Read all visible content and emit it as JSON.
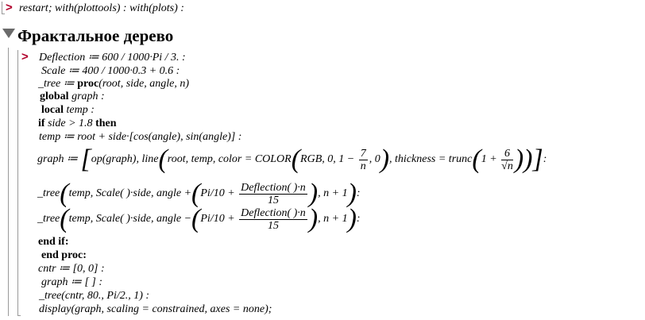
{
  "header_line": {
    "prompt": ">",
    "text": "restart; with(plottools) : with(plots) :"
  },
  "section": {
    "title": "Фрактальное дерево"
  },
  "code": {
    "prompt": ">",
    "l1": "Deflection ≔ 600 / 1000·Pi / 3. :",
    "l2": "Scale ≔ 400 / 1000·0.3 + 0.6 :",
    "l3_a": "_tree ≔ ",
    "l3_b": "proc",
    "l3_c": "(root, side, angle, n)",
    "l4_a": "global",
    "l4_b": " graph :",
    "l5_a": "local",
    "l5_b": " temp :",
    "l6_a": "if",
    "l6_b": " side > 1.8 ",
    "l6_c": "then",
    "l7": "temp ≔ root + side·[cos(angle), sin(angle)] :",
    "l8_a": "graph ≔ ",
    "l8_b": "op(graph), line",
    "l8_c": "root, temp, color = COLOR",
    "l8_d": "RGB, 0, 1 − ",
    "l8_num1": "7",
    "l8_den1": "n",
    "l8_e": ", 0",
    "l8_f": ", thickness = trunc",
    "l8_g": "1 + ",
    "l8_num2": "6",
    "l8_den2": "√n",
    "l8_end": ":",
    "l9_a": "_tree",
    "l9_b": "temp, Scale( )·side, angle +",
    "l9_c": "Pi/10 + ",
    "l9_num": "Deflection( )·n",
    "l9_den": "15",
    "l9_d": ", n + 1",
    "l9_end": ":",
    "l10_a": "_tree",
    "l10_b": "temp, Scale( )·side, angle −",
    "l10_c": "Pi/10 + ",
    "l10_num": "Deflection( )·n",
    "l10_den": "15",
    "l10_d": ", n + 1",
    "l10_end": ":",
    "l11": "end if:",
    "l12": "end proc:",
    "l13": "cntr ≔ [0, 0] :",
    "l14": "graph ≔ [ ] :",
    "l15": "_tree(cntr, 80., Pi/2., 1) :",
    "l16": "display(graph, scaling = constrained, axes = none);"
  },
  "colors": {
    "prompt": "#b0002a",
    "bracket": "#999999",
    "section_triangle": "#6b6b6b"
  }
}
